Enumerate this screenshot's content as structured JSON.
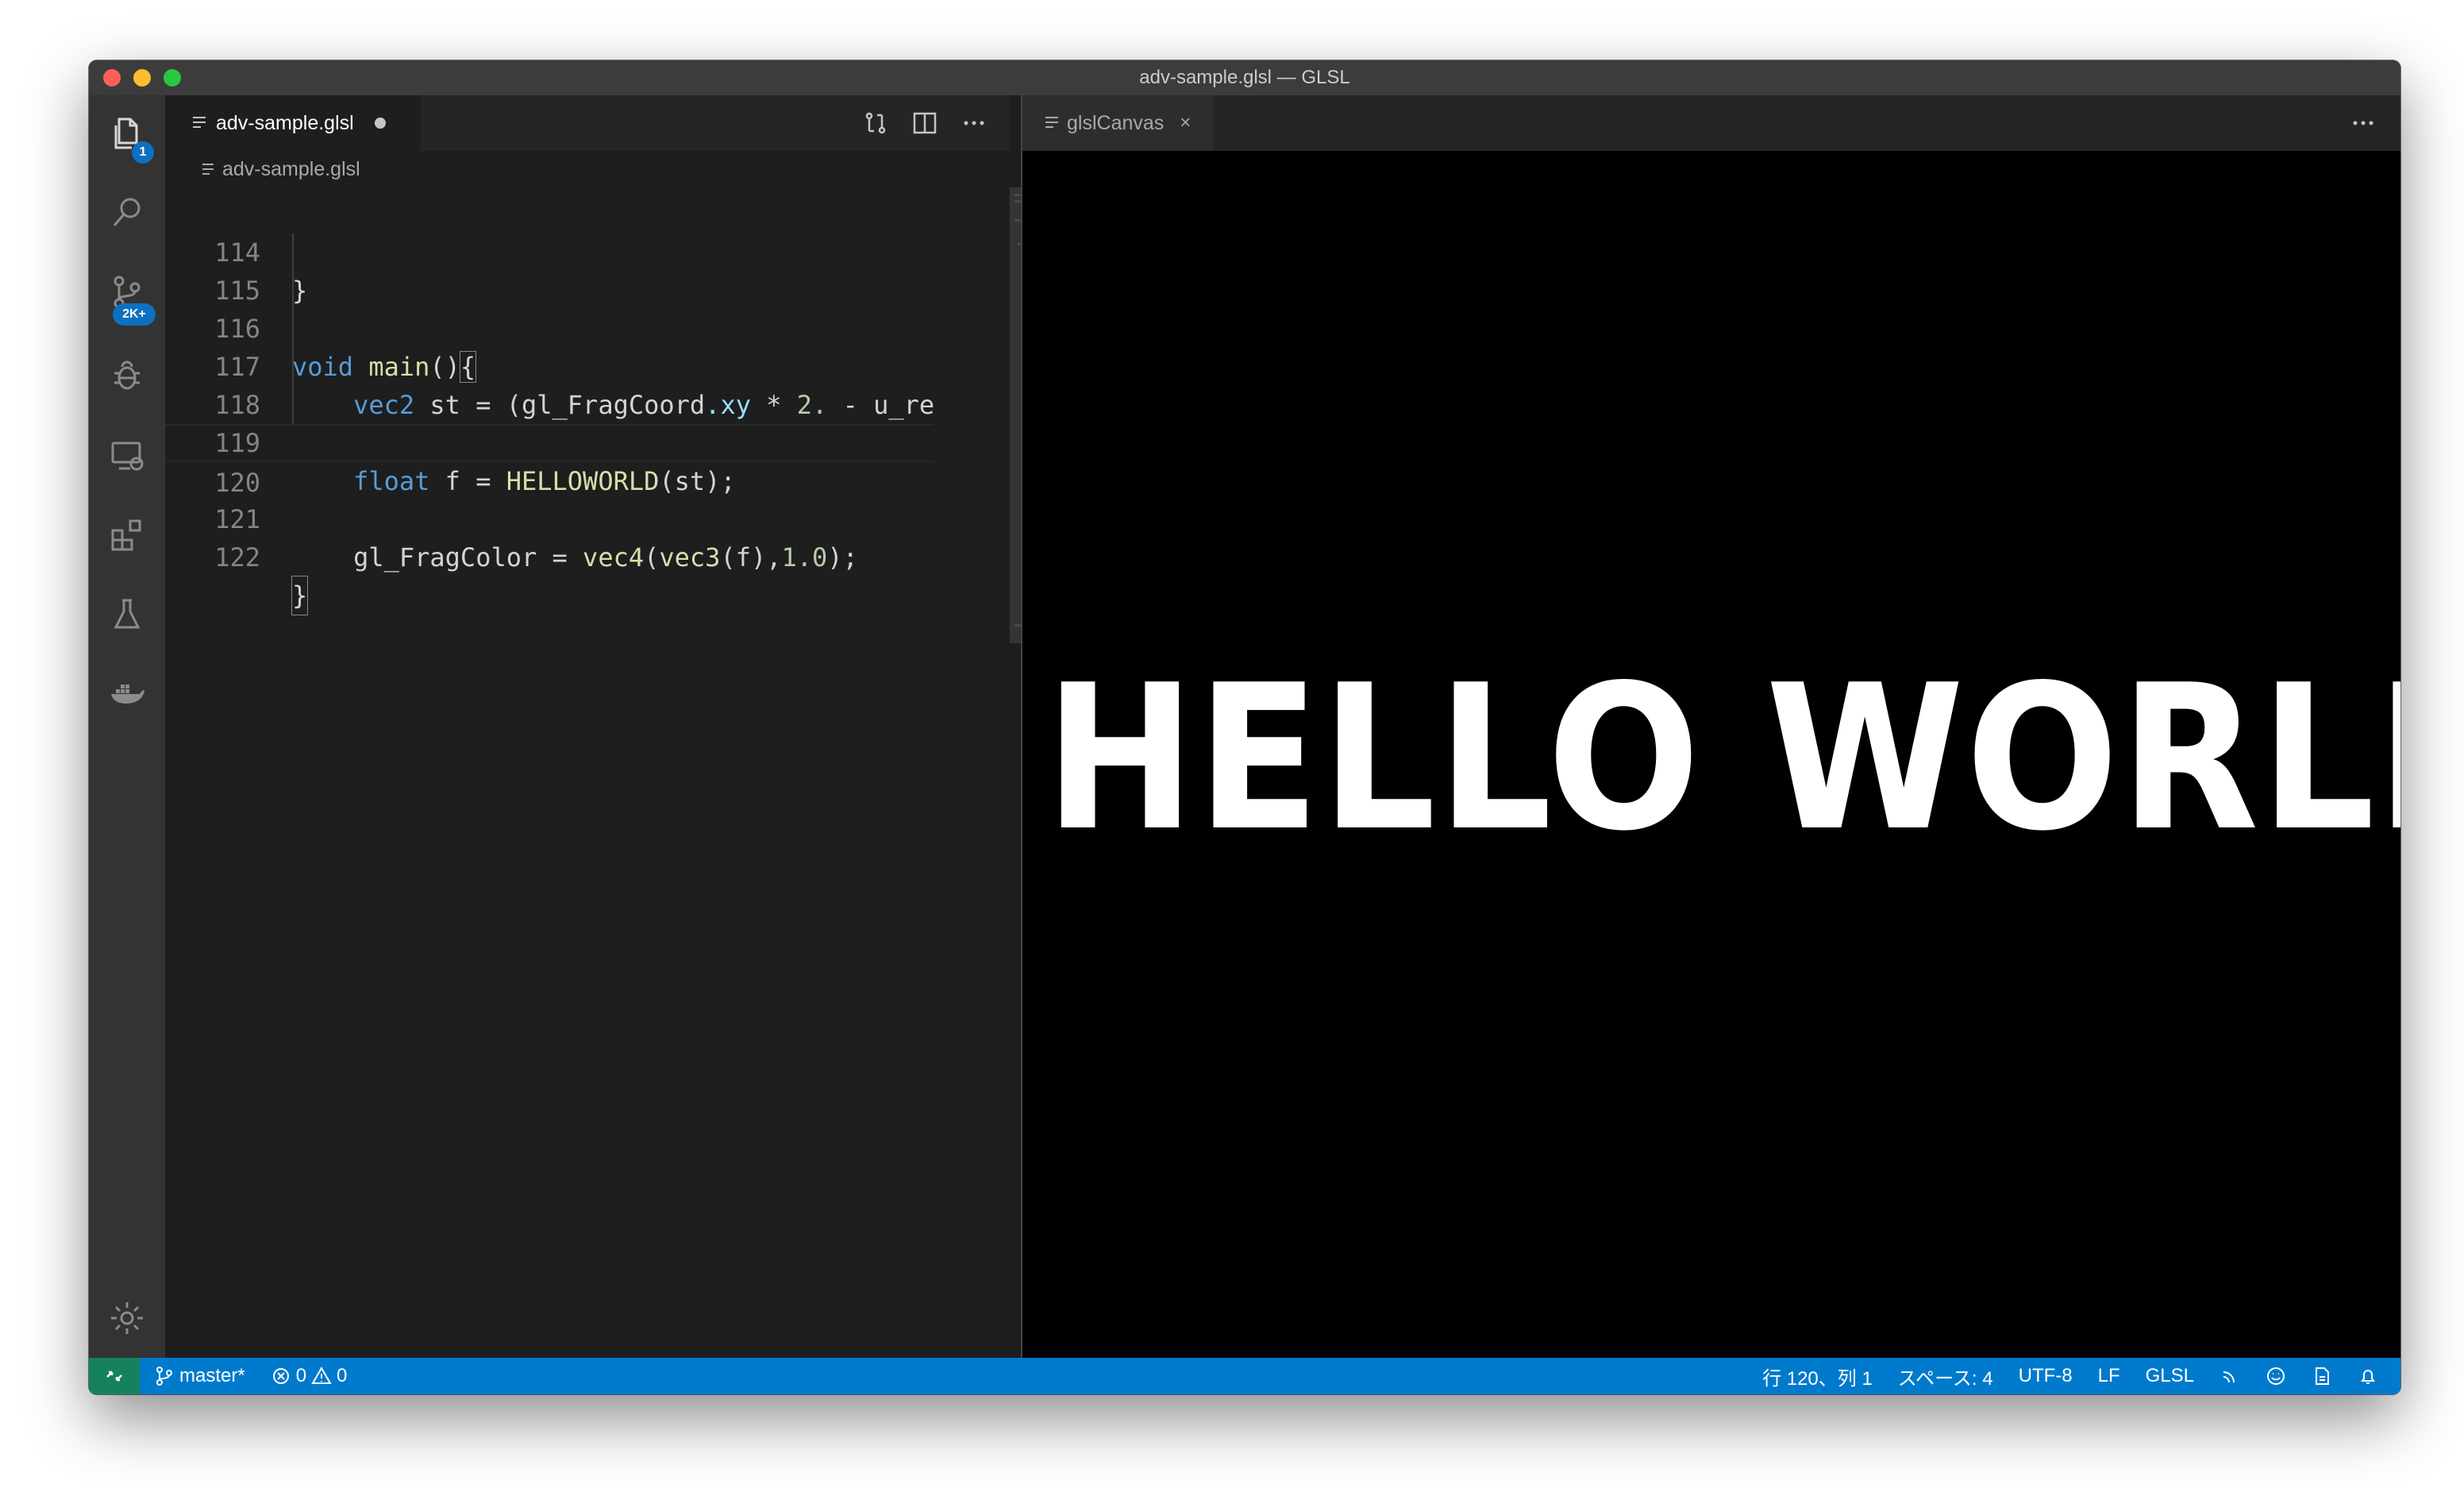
{
  "window": {
    "title": "adv-sample.glsl — GLSL"
  },
  "activity_bar": {
    "explorer_badge": "1",
    "scm_badge": "2K+"
  },
  "editor_left": {
    "tab_label": "adv-sample.glsl",
    "breadcrumb": "adv-sample.glsl",
    "lines": [
      {
        "num": "114",
        "text": "}"
      },
      {
        "num": "115",
        "text": ""
      },
      {
        "num": "116",
        "text": "void main(){"
      },
      {
        "num": "117",
        "text": "    vec2 st = (gl_FragCoord.xy * 2. - u_re"
      },
      {
        "num": "118",
        "text": ""
      },
      {
        "num": "119",
        "text": "    float f = HELLOWORLD(st);"
      },
      {
        "num": "120",
        "text": ""
      },
      {
        "num": "121",
        "text": "    gl_FragColor = vec4(vec3(f),1.0);"
      },
      {
        "num": "122",
        "text": "}"
      }
    ]
  },
  "editor_right": {
    "tab_label": "glslCanvas",
    "canvas_text": "HELLO WORLD!!"
  },
  "status_bar": {
    "branch": "master*",
    "errors": "0",
    "warnings": "0",
    "position": "行 120、列 1",
    "indent": "スペース: 4",
    "encoding": "UTF-8",
    "eol": "LF",
    "language": "GLSL"
  },
  "colors": {
    "status_bar": "#007acc",
    "remote": "#16825d",
    "keyword": "#569cd6",
    "function": "#dcdcaa",
    "variable": "#9cdcfe",
    "number": "#b5cea8"
  }
}
